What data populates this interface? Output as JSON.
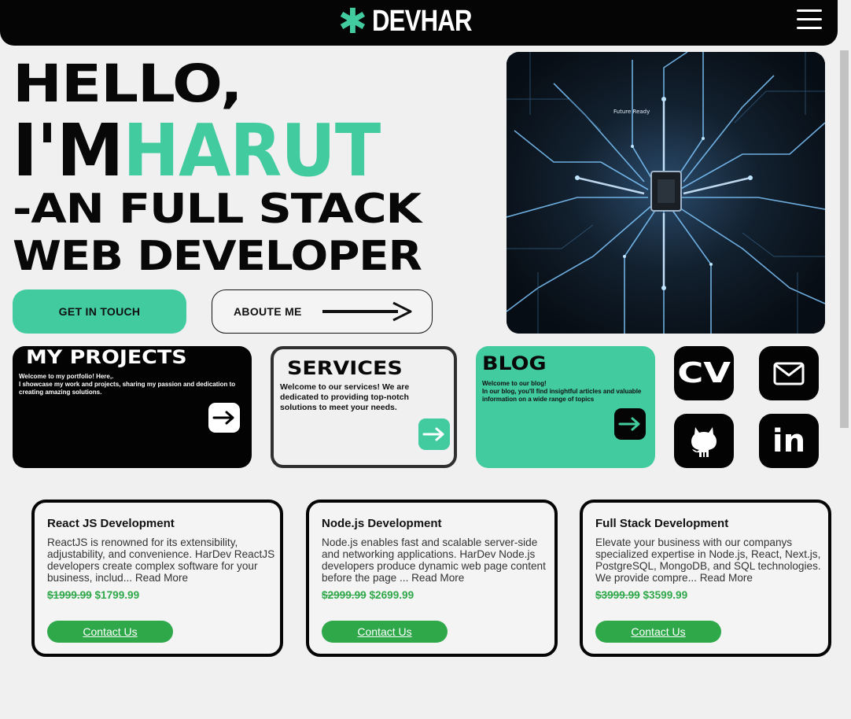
{
  "header": {
    "logo_star": "✱",
    "logo_text": "DEVHAR"
  },
  "hero": {
    "line1": "HELLO,",
    "line2_a": "I'M",
    "line2_b": "HARUT",
    "line3": "-AN FULL STACK",
    "line4": "WEB DEVELOPER",
    "btn_touch": "GET IN TOUCH",
    "btn_about": "ABOUTE ME",
    "image_chip_label": "Future Ready"
  },
  "cards": {
    "projects": {
      "title": "MY PROJECTS",
      "text_line1": "Welcome to my portfolio! Here,.",
      "text_line2": "I showcase my work and projects, sharing my passion and dedication to creating amazing solutions."
    },
    "services": {
      "title": "SERVICES",
      "text": "Welcome to our services! We are dedicated to providing top-notch solutions to meet your needs."
    },
    "blog": {
      "title": "BLOG",
      "text_line1": "Welcome to our blog!",
      "text_line2": "In our blog, you'll find insightful articles and valuable information on a wide range of topics"
    }
  },
  "social": {
    "cv": "CV",
    "linkedin": "in"
  },
  "services": [
    {
      "title": "React JS Development",
      "desc": "ReactJS is renowned for its extensibility, adjustability, and convenience. HarDev ReactJS developers create complex software for your business, includ... Read More",
      "old_price": "$1999.99",
      "new_price": "$1799.99",
      "contact": "Contact Us"
    },
    {
      "title": "Node.js Development",
      "desc": "Node.js enables fast and scalable server-side and networking applications. HarDev Node.js developers produce dynamic web page content before the page ... Read More",
      "old_price": "$2999.99",
      "new_price": "$2699.99",
      "contact": "Contact Us"
    },
    {
      "title": "Full Stack Development",
      "desc": "Elevate your business with our companys specialized expertise in Node.js, React, Next.js, PostgreSQL, MongoDB, and SQL technologies. We provide compre... Read More",
      "old_price": "$3999.99",
      "new_price": "$3599.99",
      "contact": "Contact Us"
    }
  ],
  "colors": {
    "accent": "#42cb9f",
    "dark": "#050505",
    "green_button": "#2fa84a"
  }
}
